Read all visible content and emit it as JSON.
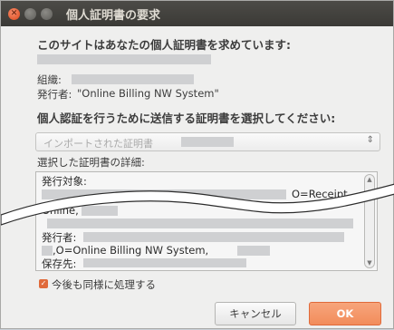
{
  "window": {
    "title": "個人証明書の要求"
  },
  "request": {
    "heading": "このサイトはあなたの個人証明書を求めています:",
    "org_label": "組織:",
    "issuer_label": "発行者:",
    "issuer_value": "\"Online Billing NW System\""
  },
  "select": {
    "heading": "個人認証を行うために送信する証明書を選択してください:",
    "combo_text": "インポートされた証明書",
    "combo_arrow": "⇕"
  },
  "details": {
    "label": "選択した証明書の詳細:",
    "lines": {
      "subject": "発行対象:",
      "receipt": "O=Receipt",
      "online": "Online,",
      "issuer": "発行者:",
      "issuer_org": ",O=Online Billing NW System,",
      "storage": "保存先:"
    }
  },
  "options": {
    "remember_label": "今後も同様に処理する",
    "remember_checked": true
  },
  "buttons": {
    "cancel": "キャンセル",
    "ok": "OK"
  }
}
